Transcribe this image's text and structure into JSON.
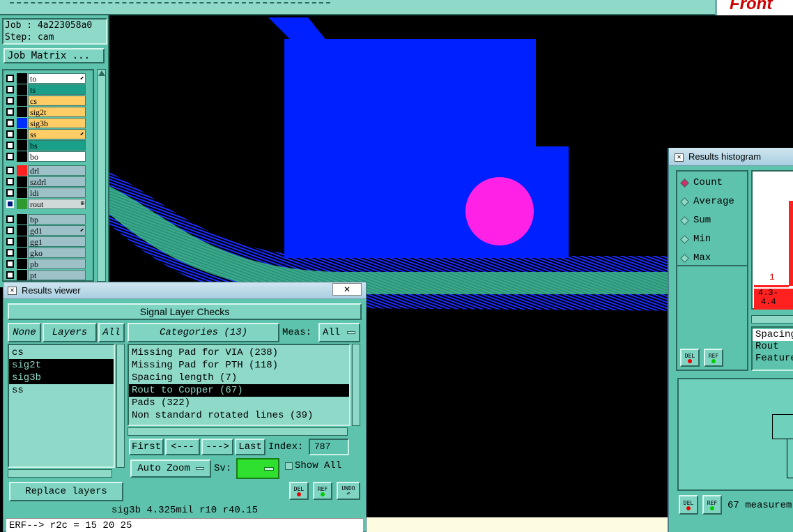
{
  "top_bar": {
    "logo_text": "Front"
  },
  "job_panel": {
    "job_line": "Job : 4a223058a0",
    "step_line": "Step: cam",
    "matrix_button": "Job Matrix ..."
  },
  "layers_group1": [
    {
      "name": "to",
      "color": "#ffffff",
      "swatch": "#000000",
      "mark": true
    },
    {
      "name": "ts",
      "color": "#1aa089",
      "swatch": "#000000",
      "mark": false
    },
    {
      "name": "cs",
      "color": "#ffcc66",
      "swatch": "#000000",
      "mark": false
    },
    {
      "name": "sig2t",
      "color": "#ffcc66",
      "swatch": "#000000",
      "mark": false
    },
    {
      "name": "sig3b",
      "color": "#ffcc66",
      "swatch": "#0030ff",
      "mark": false
    },
    {
      "name": "ss",
      "color": "#ffcc66",
      "swatch": "#000000",
      "mark": true
    },
    {
      "name": "bs",
      "color": "#1aa089",
      "swatch": "#000000",
      "mark": false
    },
    {
      "name": "bo",
      "color": "#ffffff",
      "swatch": "#000000",
      "mark": false
    }
  ],
  "layers_group2": [
    {
      "name": "drl",
      "color": "#9ec1c8",
      "swatch": "#ff2020"
    },
    {
      "name": "szdrl",
      "color": "#9ec1c8",
      "swatch": "#000000"
    },
    {
      "name": "ldi",
      "color": "#9ec1c8",
      "swatch": "#000000"
    },
    {
      "name": "rout",
      "color": "#d0d8d8",
      "swatch": "#2f9a2f"
    }
  ],
  "layers_group3": [
    {
      "name": "bp",
      "color": "#9ec1c8",
      "mark": false
    },
    {
      "name": "gd1",
      "color": "#9ec1c8",
      "mark": true
    },
    {
      "name": "gg1",
      "color": "#9ec1c8",
      "mark": false
    },
    {
      "name": "gko",
      "color": "#9ec1c8",
      "mark": false
    },
    {
      "name": "pb",
      "color": "#9ec1c8",
      "mark": false
    },
    {
      "name": "pt",
      "color": "#9ec1c8",
      "mark": false
    }
  ],
  "results_viewer": {
    "title": "Results viewer",
    "close": "✕",
    "heading": "Signal Layer Checks",
    "none_btn": "None",
    "layers_btn": "Layers",
    "all_btn": "All",
    "categories_btn": "Categories (13)",
    "meas_label": "Meas:",
    "meas_value": "All",
    "layers": [
      "cs",
      "sig2t",
      "sig3b",
      "ss"
    ],
    "categories": [
      "Missing Pad for VIA (238)",
      "Missing Pad for PTH (118)",
      "Spacing length (7)",
      "Rout to Copper (67)",
      "Pads (322)",
      "Non standard rotated lines (39)"
    ],
    "first_btn": "First",
    "prev_btn": "<---",
    "next_btn": "--->",
    "last_btn": "Last",
    "index_label": "Index:",
    "index_value": "787",
    "autozoom_btn": "Auto Zoom",
    "sv_label": "Sv:",
    "show_all": "Show All",
    "replace_btn": "Replace layers",
    "del_label": "DEL",
    "ref_label": "REF",
    "undo_label": "UNDO",
    "status_line": "sig3b 4.325mil  r10  r40.15",
    "command_line": "ERF--> r2c = 15 20 25"
  },
  "histogram": {
    "title": "Results histogram",
    "options": [
      "Count",
      "Average",
      "Sum",
      "Min",
      "Max"
    ],
    "bar_count_label": "1",
    "bin_label_line1": "4.3-",
    "bin_label_line2": "4.4",
    "list_items": [
      "Spacing",
      "Rout",
      "Feature"
    ],
    "del_label": "DEL",
    "ref_label": "REF",
    "measure_text": "67 measurem"
  },
  "colors": {
    "board_blue": "#0020ff",
    "pad_magenta": "#ff22e6",
    "track_green": "#3aa88c"
  }
}
